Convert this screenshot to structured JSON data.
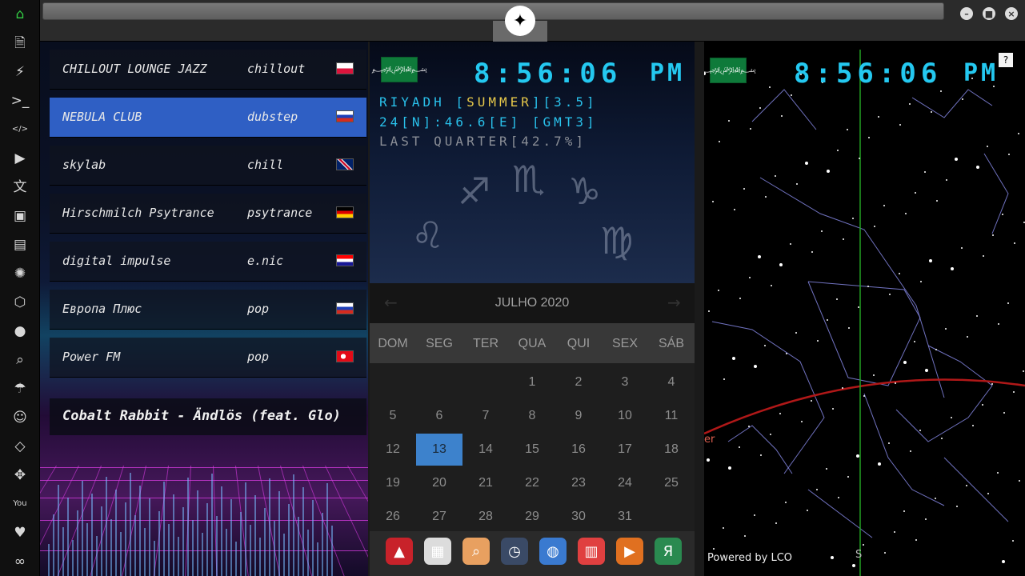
{
  "sidebar": {
    "items": [
      {
        "name": "home-icon",
        "glyph": "⌂"
      },
      {
        "name": "document-icon",
        "glyph": "🗎"
      },
      {
        "name": "lightning-icon",
        "glyph": "⚡"
      },
      {
        "name": "terminal-icon",
        "glyph": ">_"
      },
      {
        "name": "code-icon",
        "glyph": "</>"
      },
      {
        "name": "play-icon",
        "glyph": "▶"
      },
      {
        "name": "translate-icon",
        "glyph": "文"
      },
      {
        "name": "image-icon",
        "glyph": "▣"
      },
      {
        "name": "news-icon",
        "glyph": "▤"
      },
      {
        "name": "empire-icon",
        "glyph": "✺"
      },
      {
        "name": "hexagon-icon",
        "glyph": "⬡"
      },
      {
        "name": "globe-icon",
        "glyph": "●"
      },
      {
        "name": "search-icon",
        "glyph": "⌕"
      },
      {
        "name": "umbrella-icon",
        "glyph": "☂"
      },
      {
        "name": "contact-icon",
        "glyph": "☺"
      },
      {
        "name": "code-block-icon",
        "glyph": "◇"
      },
      {
        "name": "expand-icon",
        "glyph": "✥"
      },
      {
        "name": "youtube-icon",
        "glyph": "You"
      },
      {
        "name": "heart-icon",
        "glyph": "♥"
      },
      {
        "name": "cloud-icon",
        "glyph": "∞"
      }
    ]
  },
  "topbar": {
    "logo_glyph": "✦",
    "minimize": "–",
    "maximize": "■",
    "close": "×"
  },
  "radio": {
    "stations": [
      {
        "name": "CHILLOUT LOUNGE JAZZ",
        "genre": "chillout",
        "flag": "poland"
      },
      {
        "name": "NEBULA CLUB",
        "genre": "dubstep",
        "flag": "russia"
      },
      {
        "name": "skylab",
        "genre": "chill",
        "flag": "uk"
      },
      {
        "name": "Hirschmilch Psytrance",
        "genre": "psytrance",
        "flag": "germany"
      },
      {
        "name": "digital impulse",
        "genre": "e.nic",
        "flag": "croatia"
      },
      {
        "name": "Европа Плюс",
        "genre": "pop",
        "flag": "russia"
      },
      {
        "name": "Power FM",
        "genre": "pop",
        "flag": "turkey"
      }
    ],
    "selected_index": 1,
    "now_playing": "Cobalt Rabbit - Ändlös (feat. Glo)"
  },
  "clock_main": {
    "time": "8:56:06",
    "ampm": "PM",
    "line1_prefix": "RIYADH [",
    "line1_highlight": "SUMMER",
    "line1_suffix": "][3.5]",
    "line2": "24[N]:46.6[E] [GMT3]",
    "line3": "LAST QUARTER[42.7%]"
  },
  "calendar": {
    "title": "JULHO 2020",
    "weekdays": [
      "DOM",
      "SEG",
      "TER",
      "QUA",
      "QUI",
      "SEX",
      "SÁB"
    ],
    "weeks": [
      [
        "",
        "",
        "",
        "1",
        "2",
        "3",
        "4"
      ],
      [
        "5",
        "6",
        "7",
        "8",
        "9",
        "10",
        "11"
      ],
      [
        "12",
        "13",
        "14",
        "15",
        "16",
        "17",
        "18"
      ],
      [
        "19",
        "20",
        "21",
        "22",
        "23",
        "24",
        "25"
      ],
      [
        "26",
        "27",
        "28",
        "29",
        "30",
        "31",
        ""
      ]
    ],
    "today": "13",
    "prev": "←",
    "next": "→"
  },
  "dock": {
    "apps": [
      {
        "name": "archive-app-icon",
        "glyph": "▲",
        "color": "#c8222a"
      },
      {
        "name": "calendar-app-icon",
        "glyph": "▦",
        "color": "#dcdcdc"
      },
      {
        "name": "search-app-icon",
        "glyph": "⌕",
        "color": "#e8a060"
      },
      {
        "name": "clock-app-icon",
        "glyph": "◷",
        "color": "#3a4a66"
      },
      {
        "name": "globe-app-icon",
        "glyph": "◍",
        "color": "#3a7ad0"
      },
      {
        "name": "schedule-app-icon",
        "glyph": "▥",
        "color": "#e04040"
      },
      {
        "name": "play-app-icon",
        "glyph": "▶",
        "color": "#e07020"
      },
      {
        "name": "yandex-app-icon",
        "glyph": "Я",
        "color": "#2a8a50"
      }
    ]
  },
  "sky": {
    "time": "8:56:06",
    "ampm": "PM",
    "help": "?",
    "powered_by": "Powered by LCO",
    "south_label": "S",
    "horizon_label": "er"
  },
  "colors": {
    "accent_time": "#24c8f0",
    "highlight": "#e6c84a",
    "selected_station": "#2f5fc4",
    "today": "#3d82cc",
    "home_active": "#33cc44"
  }
}
